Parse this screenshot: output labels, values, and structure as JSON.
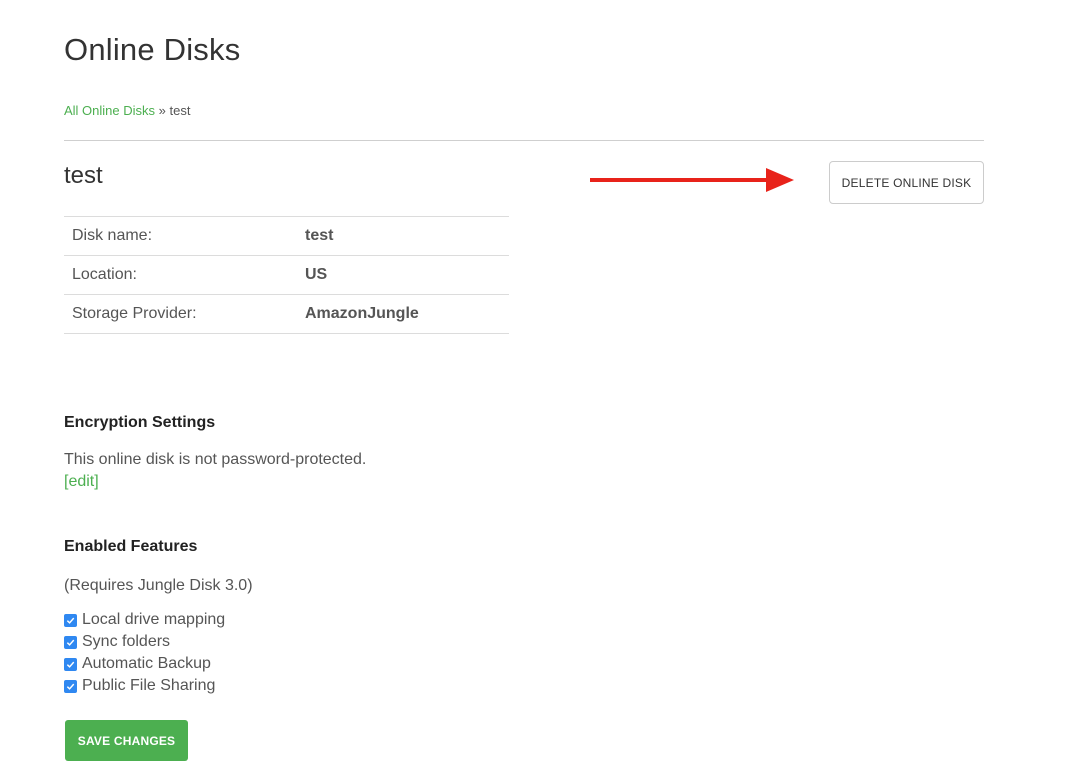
{
  "page": {
    "title": "Online Disks"
  },
  "breadcrumb": {
    "parent_label": "All Online Disks",
    "separator": "»",
    "current": "test"
  },
  "disk": {
    "title": "test"
  },
  "toolbar": {
    "delete_label": "DELETE ONLINE DISK"
  },
  "info_table": [
    {
      "label": "Disk name:",
      "value": "test"
    },
    {
      "label": "Location:",
      "value": "US"
    },
    {
      "label": "Storage Provider:",
      "value": "AmazonJungle"
    }
  ],
  "encryption": {
    "heading": "Encryption Settings",
    "text": "This online disk is not password-protected.",
    "edit_label": "[edit]"
  },
  "features": {
    "heading": "Enabled Features",
    "requires": "(Requires Jungle Disk 3.0)",
    "items": [
      {
        "label": "Local drive mapping",
        "checked": true
      },
      {
        "label": "Sync folders",
        "checked": true
      },
      {
        "label": "Automatic Backup",
        "checked": true
      },
      {
        "label": "Public File Sharing",
        "checked": true
      }
    ]
  },
  "actions": {
    "save_label": "SAVE CHANGES"
  },
  "colors": {
    "accent": "#4caf50",
    "checkbox": "#2f88f1",
    "arrow": "#e8231a"
  },
  "icons": {
    "annotation": "red-arrow-icon",
    "checkbox": "checkmark-icon"
  }
}
